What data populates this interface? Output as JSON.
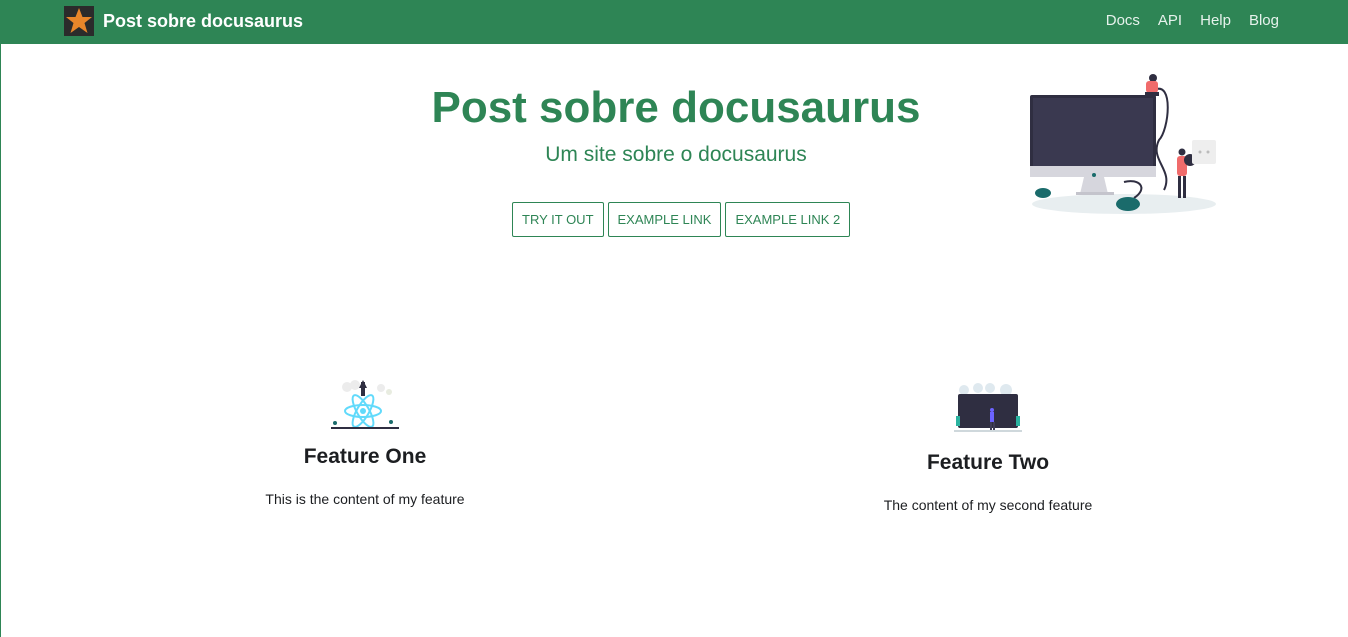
{
  "navbar": {
    "brand_title": "Post sobre docusaurus",
    "logo_icon": "star-icon",
    "links": [
      "Docs",
      "API",
      "Help",
      "Blog"
    ]
  },
  "hero": {
    "title": "Post sobre docusaurus",
    "subtitle": "Um site sobre o docusaurus",
    "buttons": [
      "TRY IT OUT",
      "EXAMPLE LINK",
      "EXAMPLE LINK 2"
    ],
    "illustration": "computer-cleaning-illustration"
  },
  "features": [
    {
      "title": "Feature One",
      "content": "This is the content of my feature",
      "image": "react-atom-illustration"
    },
    {
      "title": "Feature Two",
      "content": "The content of my second feature",
      "image": "dark-screen-person-illustration"
    }
  ],
  "colors": {
    "primary": "#2e8555",
    "text": "#1c1e21",
    "accent_orange": "#e8862a",
    "illustration_dark": "#2f2e41",
    "illustration_pink": "#f06b6b",
    "illustration_teal": "#1a6b6b"
  }
}
